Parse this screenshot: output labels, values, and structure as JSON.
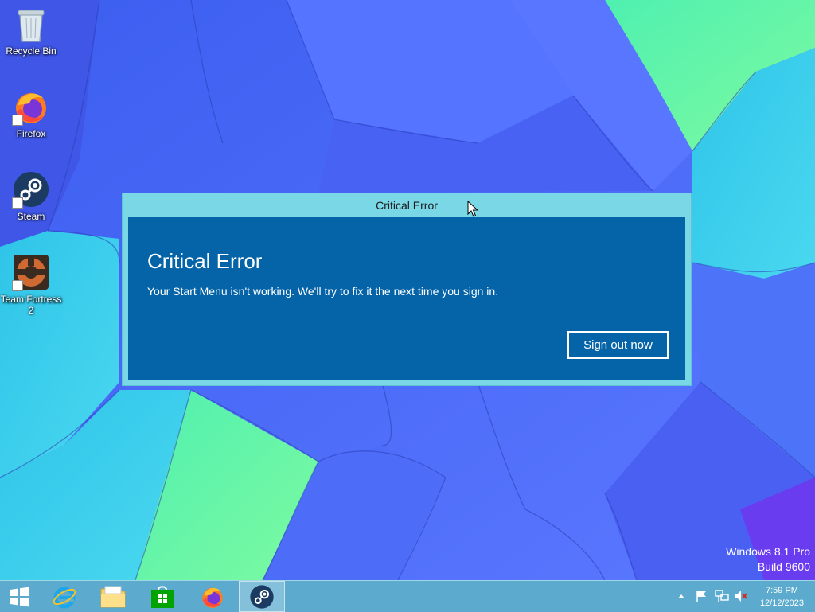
{
  "desktop": {
    "icons": [
      {
        "label": "Recycle Bin",
        "icon": "recycle-bin-icon"
      },
      {
        "label": "Firefox",
        "icon": "firefox-icon"
      },
      {
        "label": "Steam",
        "icon": "steam-icon"
      },
      {
        "label": "Team Fortress 2",
        "icon": "tf2-icon"
      }
    ]
  },
  "dialog": {
    "title": "Critical Error",
    "heading": "Critical Error",
    "message": "Your Start Menu isn't working. We'll try to fix it the next time you sign in.",
    "button_label": "Sign out now"
  },
  "watermark": {
    "line1": "Windows 8.1 Pro",
    "line2": "Build 9600"
  },
  "taskbar": {
    "pinned": [
      {
        "name": "start-button",
        "icon": "windows-logo-icon"
      },
      {
        "name": "internet-explorer",
        "icon": "ie-icon"
      },
      {
        "name": "file-explorer",
        "icon": "folder-icon"
      },
      {
        "name": "store",
        "icon": "store-icon"
      },
      {
        "name": "firefox",
        "icon": "firefox-icon"
      },
      {
        "name": "steam",
        "icon": "steam-icon",
        "active": true
      }
    ],
    "tray": {
      "icons": [
        "show-hidden-icons-icon",
        "action-center-flag-icon",
        "network-icon",
        "volume-muted-icon"
      ],
      "time": "7:59 PM",
      "date": "12/12/2023"
    }
  },
  "colors": {
    "dialog_frame": "#7ad8e6",
    "dialog_body": "#0564a8",
    "taskbar": "#60b2cc"
  }
}
